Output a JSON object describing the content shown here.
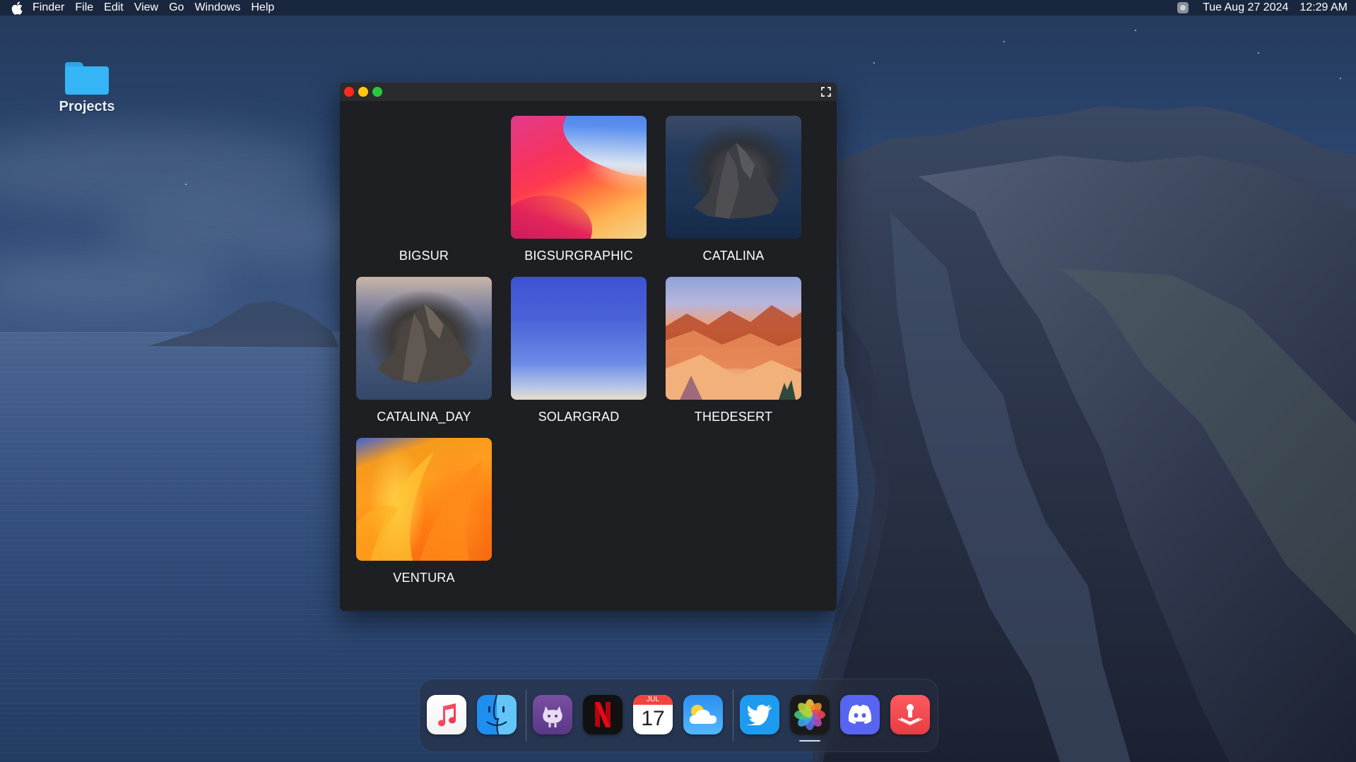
{
  "menubar": {
    "app_name": "Finder",
    "items": [
      "File",
      "Edit",
      "View",
      "Go",
      "Windows",
      "Help"
    ],
    "date": "Tue Aug 27 2024",
    "time": "12:29 AM"
  },
  "desktop": {
    "folder_label": "Projects"
  },
  "window": {
    "wallpapers": [
      {
        "name": "BIGSUR",
        "thumb": "empty"
      },
      {
        "name": "BIGSURGRAPHIC",
        "thumb": "bigsurgraphic"
      },
      {
        "name": "CATALINA",
        "thumb": "catalina"
      },
      {
        "name": "CATALINA_DAY",
        "thumb": "catalina-day"
      },
      {
        "name": "SOLARGRAD",
        "thumb": "solargrad"
      },
      {
        "name": "THEDESERT",
        "thumb": "thedesert"
      },
      {
        "name": "VENTURA",
        "thumb": "ventura"
      }
    ]
  },
  "dock": {
    "apps": [
      {
        "name": "music",
        "icon": "music-note-icon"
      },
      {
        "name": "finder",
        "icon": "finder-face-icon"
      },
      {
        "name": "github",
        "icon": "octocat-icon"
      },
      {
        "name": "netflix",
        "icon": "netflix-n-icon",
        "glyph": "N"
      },
      {
        "name": "calendar",
        "icon": "calendar-icon",
        "month": "JUL",
        "day": "17"
      },
      {
        "name": "weather",
        "icon": "weather-cloud-icon"
      },
      {
        "name": "twitter",
        "icon": "twitter-bird-icon"
      },
      {
        "name": "photos",
        "icon": "photos-flower-icon",
        "running": true
      },
      {
        "name": "discord",
        "icon": "discord-icon"
      },
      {
        "name": "dropzone",
        "icon": "dropzone-icon"
      }
    ]
  },
  "colors": {
    "traffic_close": "#ff2a1c",
    "traffic_minimize": "#ffca11",
    "traffic_maximize": "#2ac840",
    "window_bg": "#1e1f23",
    "folder_blue": "#35b5f5"
  }
}
